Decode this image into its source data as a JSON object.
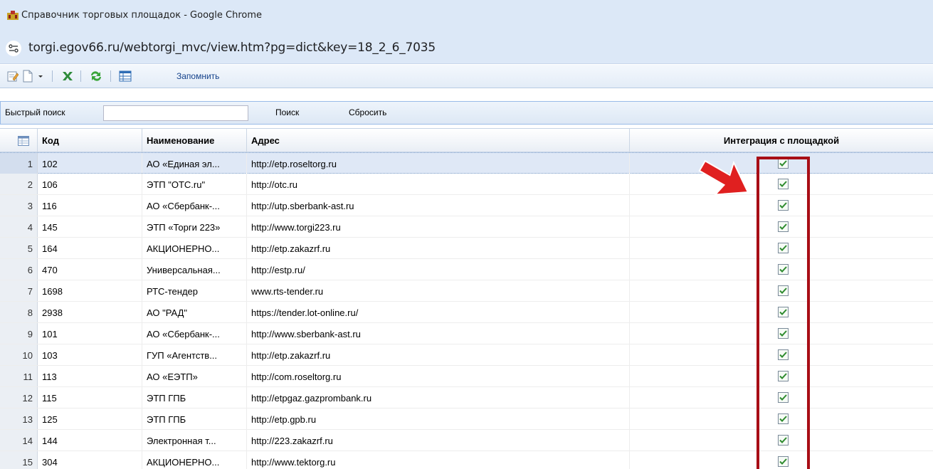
{
  "window": {
    "title": "Справочник торговых площадок - Google Chrome",
    "url": "torgi.egov66.ru/webtorgi_mvc/view.htm?pg=dict&key=18_2_6_7035"
  },
  "toolbar": {
    "remember_label": "Запомнить",
    "icons": [
      "edit-icon",
      "new-document-icon",
      "dropdown-caret-icon",
      "excel-export-icon",
      "refresh-icon",
      "grid-settings-icon"
    ]
  },
  "search": {
    "label": "Быстрый поиск",
    "value": "",
    "placeholder": "",
    "search_button": "Поиск",
    "reset_button": "Сбросить"
  },
  "grid": {
    "columns": [
      "Код",
      "Наименование",
      "Адрес",
      "Интеграция с площадкой"
    ],
    "rows": [
      {
        "n": "1",
        "code": "102",
        "name": "АО «Единая эл...",
        "address": "http://etp.roseltorg.ru",
        "integrated": true,
        "selected": true
      },
      {
        "n": "2",
        "code": "106",
        "name": "ЭТП \"ОТС.ru\"",
        "address": "http://otc.ru",
        "integrated": true
      },
      {
        "n": "3",
        "code": "116",
        "name": "АО «Сбербанк-...",
        "address": "http://utp.sberbank-ast.ru",
        "integrated": true
      },
      {
        "n": "4",
        "code": "145",
        "name": "ЭТП «Торги 223»",
        "address": "http://www.torgi223.ru",
        "integrated": true
      },
      {
        "n": "5",
        "code": "164",
        "name": "АКЦИОНЕРНО...",
        "address": "http://etp.zakazrf.ru",
        "integrated": true
      },
      {
        "n": "6",
        "code": "470",
        "name": "Универсальная...",
        "address": "http://estp.ru/",
        "integrated": true
      },
      {
        "n": "7",
        "code": "1698",
        "name": "РТС-тендер",
        "address": "www.rts-tender.ru",
        "integrated": true
      },
      {
        "n": "8",
        "code": "2938",
        "name": "АО \"РАД\"",
        "address": "https://tender.lot-online.ru/",
        "integrated": true
      },
      {
        "n": "9",
        "code": "101",
        "name": "АО «Сбербанк-...",
        "address": "http://www.sberbank-ast.ru",
        "integrated": true
      },
      {
        "n": "10",
        "code": "103",
        "name": "ГУП «Агентств...",
        "address": "http://etp.zakazrf.ru",
        "integrated": true
      },
      {
        "n": "11",
        "code": "113",
        "name": "АО «ЕЭТП»",
        "address": "http://com.roseltorg.ru",
        "integrated": true
      },
      {
        "n": "12",
        "code": "115",
        "name": "ЭТП ГПБ",
        "address": "http://etpgaz.gazprombank.ru",
        "integrated": true
      },
      {
        "n": "13",
        "code": "125",
        "name": "ЭТП ГПБ",
        "address": "http://etp.gpb.ru",
        "integrated": true
      },
      {
        "n": "14",
        "code": "144",
        "name": "Электронная т...",
        "address": "http://223.zakazrf.ru",
        "integrated": true
      },
      {
        "n": "15",
        "code": "304",
        "name": "АКЦИОНЕРНО...",
        "address": "http://www.tektorg.ru",
        "integrated": true
      }
    ]
  },
  "colors": {
    "highlight": "#a80e16",
    "arrow": "#e02020",
    "check": "#2e8b2e"
  }
}
